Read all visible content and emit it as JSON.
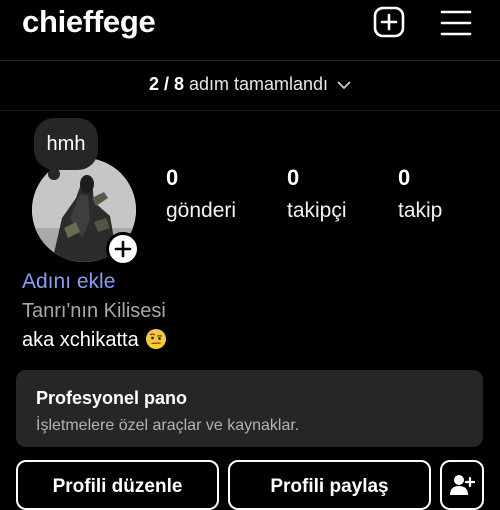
{
  "header": {
    "username": "chieffege",
    "add_icon": "plus-square-icon",
    "menu_icon": "hamburger-menu-icon"
  },
  "steps": {
    "count": "2 / 8",
    "label": "adım tamamlandı"
  },
  "profile": {
    "note": "hmh",
    "avatar_icon": "profile-photo",
    "add_story_icon": "plus-icon"
  },
  "stats": [
    {
      "value": "0",
      "label": "gönderi"
    },
    {
      "value": "0",
      "label": "takipçi"
    },
    {
      "value": "0",
      "label": "takip"
    }
  ],
  "bio": {
    "add_name": "Adını ekle",
    "category": "Tanrı'nın Kilisesi",
    "text": "aka xchikatta",
    "emoji_icon": "face-with-raised-eyebrow-emoji"
  },
  "professional": {
    "title": "Profesyonel pano",
    "subtitle": "İşletmelere özel araçlar ve kaynaklar."
  },
  "actions": {
    "edit_label": "Profili düzenle",
    "share_label": "Profili paylaş",
    "suggest_icon": "add-person-icon"
  },
  "colors": {
    "background": "#000000",
    "card": "#262626",
    "link": "#8a9bf5",
    "secondary_text": "#a8a8a8"
  }
}
